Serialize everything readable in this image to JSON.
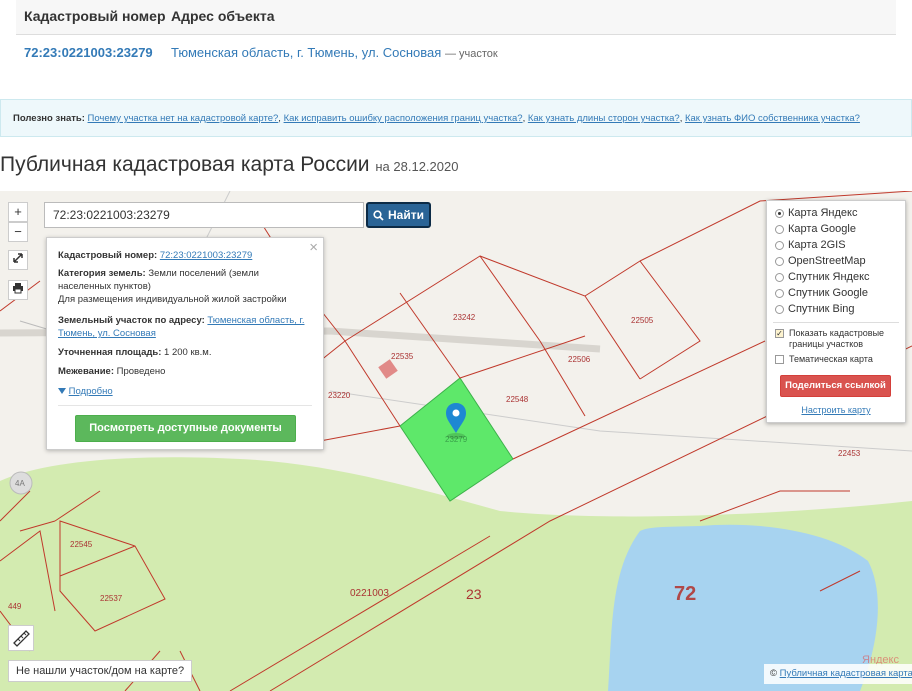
{
  "results_table": {
    "col_cadastral": "Кадастровый номер",
    "col_address": "Адрес объекта",
    "row": {
      "cadastral_number": "72:23:0221003:23279",
      "address": "Тюменская область, г. Тюмень, ул. Сосновая",
      "object_type": "— участок"
    }
  },
  "info_bar": {
    "label": "Полезно знать:",
    "links": [
      "Почему участка нет на кадастровой карте?",
      "Как исправить ошибку расположения границ участка?",
      "Как узнать длины сторон участка?",
      "Как узнать ФИО собственника участка?"
    ]
  },
  "page": {
    "title": "Публичная кадастровая карта России",
    "date": "на 28.12.2020"
  },
  "map": {
    "zoom_in": "+",
    "zoom_out": "−",
    "search_value": "72:23:0221003:23279",
    "search_button": "Найти",
    "popup": {
      "close": "×",
      "cadastral_label": "Кадастровый номер:",
      "cadastral_value": "72:23:0221003:23279",
      "category_label": "Категория земель:",
      "category_value_1": "Земли поселений (земли",
      "category_value_2": "населенных пунктов)",
      "usage_value": "Для размещения индивидуальной жилой застройки",
      "address_label": "Земельный участок по адресу:",
      "address_value_1": "Тюменская область, г.",
      "address_value_2": "Тюмень, ул. Сосновая",
      "area_label": "Уточненная площадь:",
      "area_value": "1 200 кв.м.",
      "survey_label": "Межевание:",
      "survey_value": "Проведено",
      "details_link": "Подробно",
      "docs_button": "Посмотреть доступные документы"
    },
    "layers": {
      "options": [
        "Карта Яндекс",
        "Карта Google",
        "Карта 2GIS",
        "OpenStreetMap",
        "Спутник Яндекс",
        "Спутник Google",
        "Спутник Bing"
      ],
      "selected": "Карта Яндекс",
      "show_borders_1": "Показать кадастровые",
      "show_borders_2": "границы участков",
      "thematic": "Тематическая карта",
      "share_button": "Поделиться ссылкой",
      "setup_link": "Настроить карту"
    },
    "not_found_button": "Не нашли участок/дом на карте?",
    "copyright_symbol": "©",
    "copyright_link": "Публичная кадастровая карта",
    "labels": {
      "p23242": "23242",
      "p22505": "22505",
      "p22535": "22535",
      "p22506": "22506",
      "p23220": "23220",
      "p22548": "22548",
      "p23279": "23279",
      "p22453": "22453",
      "p22545": "22545",
      "p22537": "22537",
      "p449": "449",
      "quarter": "0221003",
      "district": "23",
      "region": "72",
      "house": "4А",
      "yandex": "Яндекс"
    }
  },
  "colors": {
    "link": "#337ab7",
    "selected_parcel": "#5ee86a",
    "park": "#d3ebb0",
    "water": "#a7d3f0",
    "boundary": "#c0392b",
    "share": "#d9534f",
    "docs": "#5cb85c"
  }
}
